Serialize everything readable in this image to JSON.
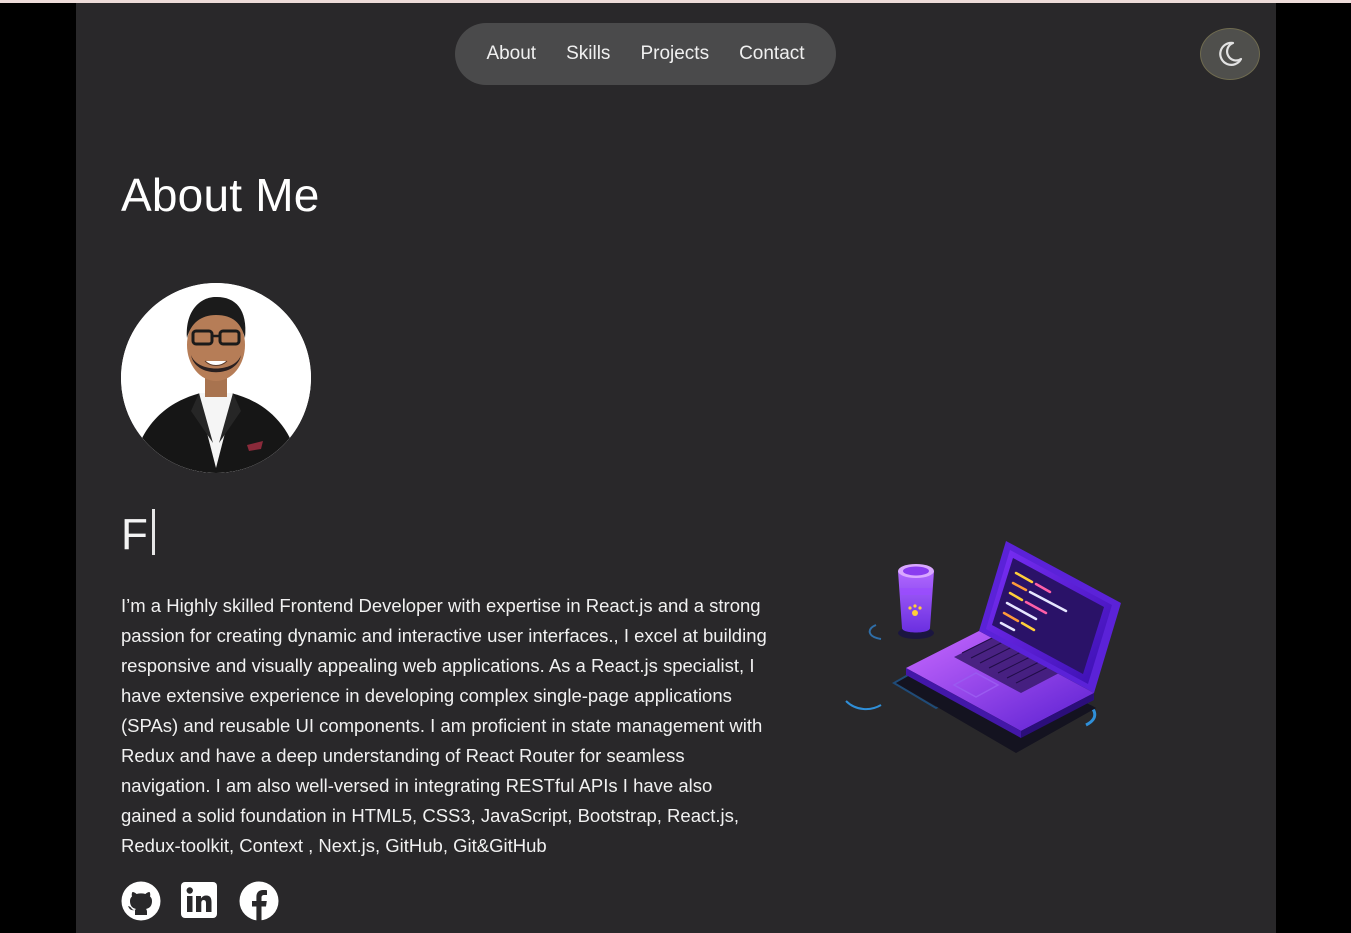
{
  "nav": {
    "items": [
      {
        "label": "About"
      },
      {
        "label": "Skills"
      },
      {
        "label": "Projects"
      },
      {
        "label": "Contact"
      }
    ]
  },
  "theme_toggle": {
    "icon": "moon-icon"
  },
  "about": {
    "title": "About Me",
    "typed_text": "F",
    "bio": "I’m a Highly skilled Frontend Developer with expertise in React.js and a strong passion for creating dynamic and interactive user interfaces., I excel at building responsive and visually appealing web applications. As a React.js specialist, I have extensive experience in developing complex single-page applications (SPAs) and reusable UI components. I am proficient in state management with Redux and have a deep understanding of React Router for seamless navigation. I am also well-versed in integrating RESTful APIs I have also gained a solid foundation in HTML5, CSS3, JavaScript, Bootstrap, React.js, Redux-toolkit, Context , Next.js, GitHub, Git&GitHub"
  },
  "socials": [
    {
      "icon": "github-icon"
    },
    {
      "icon": "linkedin-icon"
    },
    {
      "icon": "facebook-icon"
    }
  ],
  "colors": {
    "page_background": "#29282a",
    "outer_background": "#000000",
    "nav_background": "#4a4a4b",
    "text": "#f1f1f1",
    "accent_purple": "#7b2ff7"
  }
}
